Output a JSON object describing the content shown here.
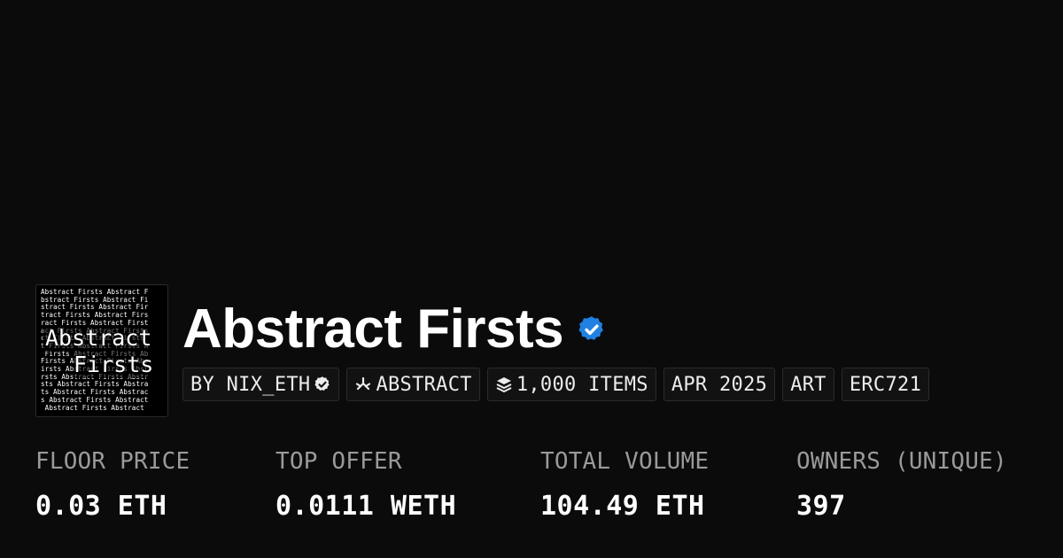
{
  "collection": {
    "thumbnail": {
      "pattern_lines": [
        "Abstract Firsts Abstract F",
        "bstract Firsts Abstract Fi",
        "stract Firsts Abstract Fir",
        "tract Firsts Abstract Firs",
        "ract Firsts Abstract First",
        "act Firsts Abstract Firsts",
        "ct Firsts Abstract Firsts ",
        "t Firsts Abstract Firsts A",
        " Firsts Abstract Firsts Ab",
        "Firsts Abstract Firsts Abs",
        "irsts Abstract Firsts Abst",
        "rsts Abstract Firsts Abstr",
        "sts Abstract Firsts Abstra",
        "ts Abstract Firsts Abstrac",
        "s Abstract Firsts Abstract",
        " Abstract Firsts Abstract "
      ],
      "overlay_line1": "Abstract",
      "overlay_line2": "Firsts"
    },
    "title": "Abstract Firsts",
    "verified_icon": "verified-badge-icon",
    "accent_color": "#2081e2"
  },
  "chips": {
    "creator": "BY NIX_ETH",
    "chain": "ABSTRACT",
    "items": "1,000 ITEMS",
    "date": "APR 2025",
    "category": "ART",
    "standard": "ERC721"
  },
  "stats": {
    "floor_label": "FLOOR PRICE",
    "floor_value": "0.03 ETH",
    "offer_label": "TOP OFFER",
    "offer_value": "0.0111 WETH",
    "volume_label": "TOTAL VOLUME",
    "volume_value": "104.49 ETH",
    "owners_label": "OWNERS (UNIQUE)",
    "owners_value": "397"
  }
}
